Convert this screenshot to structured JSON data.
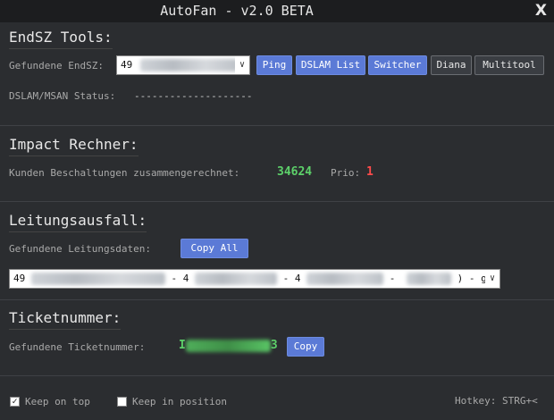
{
  "window": {
    "title": "AutoFan - v2.0 BETA",
    "close": "X"
  },
  "endsz": {
    "section_title": "EndSZ Tools:",
    "found_label": "Gefundene EndSZ:",
    "found_value": "49",
    "buttons": {
      "ping": "Ping",
      "dslam_list": "DSLAM List",
      "switcher": "Switcher",
      "diana": "Diana",
      "multitool": "Multitool"
    },
    "status_label": "DSLAM/MSAN Status:",
    "status_value": "--------------------"
  },
  "impact": {
    "section_title": "Impact Rechner:",
    "label": "Kunden Beschaltungen zusammengerechnet:",
    "value": "34624",
    "prio_label": "Prio:",
    "prio_value": "1"
  },
  "leitung": {
    "section_title": "Leitungsausfall:",
    "label": "Gefundene Leitungsdaten:",
    "copy_all": "Copy All",
    "seg1": "49",
    "sep1": "- 4",
    "sep2": "- 4",
    "sep3": "-",
    "tail": ") - ge"
  },
  "ticket": {
    "section_title": "Ticketnummer:",
    "label": "Gefundene Ticketnummer:",
    "value_start": "I",
    "value_end": "3",
    "copy": "Copy"
  },
  "footer": {
    "keep_on_top": "Keep on top",
    "keep_on_top_checked": true,
    "keep_in_position": "Keep in position",
    "keep_in_position_checked": false,
    "hotkey": "Hotkey: STRG+<"
  }
}
